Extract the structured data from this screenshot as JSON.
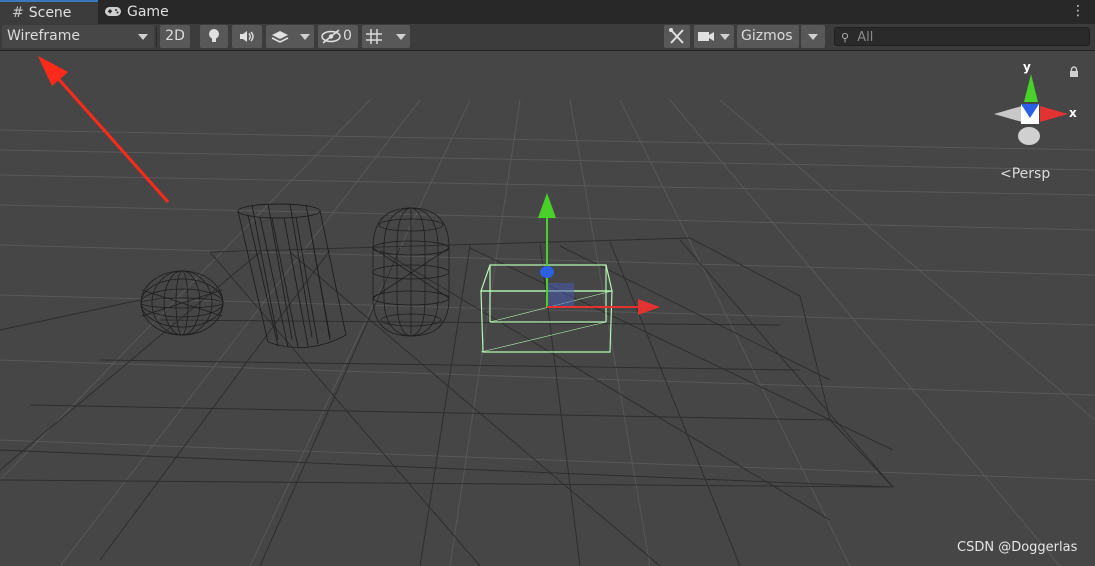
{
  "tabs": [
    {
      "label": "Scene",
      "icon": "hash-icon",
      "active": true
    },
    {
      "label": "Game",
      "icon": "gamepad-icon",
      "active": false
    }
  ],
  "toolbar": {
    "draw_mode": "Wireframe",
    "mode_2d": "2D",
    "hidden_count": "0",
    "gizmos": "Gizmos",
    "search_placeholder": "All"
  },
  "scene": {
    "projection": "Persp",
    "axis_x": "x",
    "axis_y": "y",
    "objects": [
      "sphere",
      "cylinder",
      "capsule",
      "cube"
    ]
  },
  "colors": {
    "background": "#464646",
    "grid": "#2f2f2f",
    "selection": "#a8f0a8",
    "x_axis": "#e23232",
    "y_axis": "#4ad02a",
    "z_axis": "#2a5fe6",
    "arrow": "#ff2a1a"
  },
  "watermark": "CSDN @Doggerlas"
}
